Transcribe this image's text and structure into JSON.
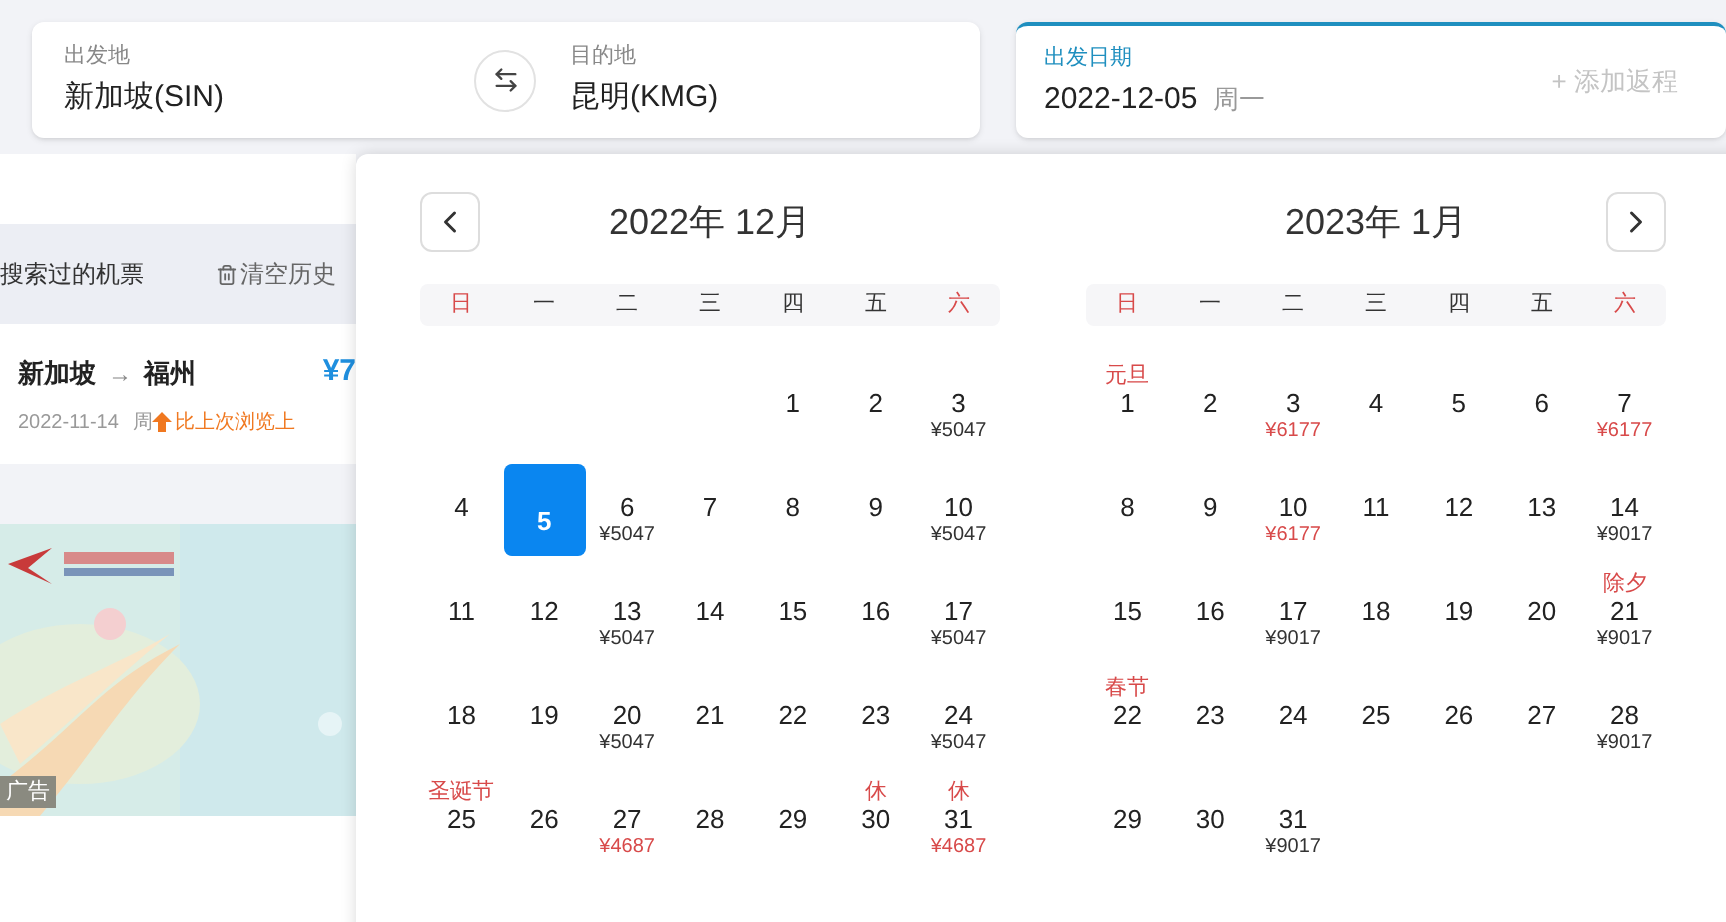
{
  "search": {
    "origin": {
      "label": "出发地",
      "value": "新加坡(SIN)"
    },
    "destination": {
      "label": "目的地",
      "value": "昆明(KMG)"
    },
    "date": {
      "label": "出发日期",
      "value": "2022-12-05",
      "weekday": "周一",
      "add_return": "+ 添加返程"
    }
  },
  "history": {
    "title": "搜索过的机票",
    "clear": "清空历史",
    "item": {
      "from": "新加坡",
      "arrow": "→",
      "to": "福州",
      "price": "¥7",
      "date": "2022-11-14",
      "weekday": "周",
      "trend": "比上次浏览上"
    }
  },
  "ad": {
    "kind": "picture",
    "tag": "广告"
  },
  "calendar": {
    "months": [
      {
        "title": "2022年 12月",
        "kind": "prev",
        "weekdays": [
          {
            "label": "日",
            "weekend": true
          },
          {
            "label": "一",
            "weekend": false
          },
          {
            "label": "二",
            "weekend": false
          },
          {
            "label": "三",
            "weekend": false
          },
          {
            "label": "四",
            "weekend": false
          },
          {
            "label": "五",
            "weekend": false
          },
          {
            "label": "六",
            "weekend": true
          }
        ],
        "days": [
          {
            "kind": "blank"
          },
          {
            "kind": "blank"
          },
          {
            "kind": "blank"
          },
          {
            "kind": "blank"
          },
          {
            "kind": "day",
            "day": "1",
            "selected": false
          },
          {
            "kind": "day",
            "day": "2",
            "selected": false
          },
          {
            "kind": "day",
            "day": "3",
            "selected": false,
            "price": "¥5047",
            "low": false
          },
          {
            "kind": "day",
            "day": "4",
            "selected": false
          },
          {
            "kind": "day",
            "day": "5",
            "selected": true
          },
          {
            "kind": "day",
            "day": "6",
            "selected": false,
            "price": "¥5047",
            "low": false
          },
          {
            "kind": "day",
            "day": "7",
            "selected": false
          },
          {
            "kind": "day",
            "day": "8",
            "selected": false
          },
          {
            "kind": "day",
            "day": "9",
            "selected": false
          },
          {
            "kind": "day",
            "day": "10",
            "selected": false,
            "price": "¥5047",
            "low": false
          },
          {
            "kind": "day",
            "day": "11",
            "selected": false
          },
          {
            "kind": "day",
            "day": "12",
            "selected": false
          },
          {
            "kind": "day",
            "day": "13",
            "selected": false,
            "price": "¥5047",
            "low": false
          },
          {
            "kind": "day",
            "day": "14",
            "selected": false
          },
          {
            "kind": "day",
            "day": "15",
            "selected": false
          },
          {
            "kind": "day",
            "day": "16",
            "selected": false
          },
          {
            "kind": "day",
            "day": "17",
            "selected": false,
            "price": "¥5047",
            "low": false
          },
          {
            "kind": "day",
            "day": "18",
            "selected": false
          },
          {
            "kind": "day",
            "day": "19",
            "selected": false
          },
          {
            "kind": "day",
            "day": "20",
            "selected": false,
            "price": "¥5047",
            "low": false
          },
          {
            "kind": "day",
            "day": "21",
            "selected": false
          },
          {
            "kind": "day",
            "day": "22",
            "selected": false
          },
          {
            "kind": "day",
            "day": "23",
            "selected": false
          },
          {
            "kind": "day",
            "day": "24",
            "selected": false,
            "price": "¥5047",
            "low": false
          },
          {
            "kind": "day",
            "day": "25",
            "selected": false,
            "holiday": "圣诞节"
          },
          {
            "kind": "day",
            "day": "26",
            "selected": false
          },
          {
            "kind": "day",
            "day": "27",
            "selected": false,
            "price": "¥4687",
            "low": true
          },
          {
            "kind": "day",
            "day": "28",
            "selected": false
          },
          {
            "kind": "day",
            "day": "29",
            "selected": false
          },
          {
            "kind": "day",
            "day": "30",
            "selected": false,
            "holiday": "休"
          },
          {
            "kind": "day",
            "day": "31",
            "selected": false,
            "holiday": "休",
            "price": "¥4687",
            "low": true
          }
        ]
      },
      {
        "title": "2023年 1月",
        "kind": "next",
        "weekdays": [
          {
            "label": "日",
            "weekend": true
          },
          {
            "label": "一",
            "weekend": false
          },
          {
            "label": "二",
            "weekend": false
          },
          {
            "label": "三",
            "weekend": false
          },
          {
            "label": "四",
            "weekend": false
          },
          {
            "label": "五",
            "weekend": false
          },
          {
            "label": "六",
            "weekend": true
          }
        ],
        "days": [
          {
            "kind": "day",
            "day": "1",
            "selected": false,
            "holiday": "元旦"
          },
          {
            "kind": "day",
            "day": "2",
            "selected": false
          },
          {
            "kind": "day",
            "day": "3",
            "selected": false,
            "price": "¥6177",
            "low": true
          },
          {
            "kind": "day",
            "day": "4",
            "selected": false
          },
          {
            "kind": "day",
            "day": "5",
            "selected": false
          },
          {
            "kind": "day",
            "day": "6",
            "selected": false
          },
          {
            "kind": "day",
            "day": "7",
            "selected": false,
            "price": "¥6177",
            "low": true
          },
          {
            "kind": "day",
            "day": "8",
            "selected": false
          },
          {
            "kind": "day",
            "day": "9",
            "selected": false
          },
          {
            "kind": "day",
            "day": "10",
            "selected": false,
            "price": "¥6177",
            "low": true
          },
          {
            "kind": "day",
            "day": "11",
            "selected": false
          },
          {
            "kind": "day",
            "day": "12",
            "selected": false
          },
          {
            "kind": "day",
            "day": "13",
            "selected": false
          },
          {
            "kind": "day",
            "day": "14",
            "selected": false,
            "price": "¥9017",
            "low": false
          },
          {
            "kind": "day",
            "day": "15",
            "selected": false
          },
          {
            "kind": "day",
            "day": "16",
            "selected": false
          },
          {
            "kind": "day",
            "day": "17",
            "selected": false,
            "price": "¥9017",
            "low": false
          },
          {
            "kind": "day",
            "day": "18",
            "selected": false
          },
          {
            "kind": "day",
            "day": "19",
            "selected": false
          },
          {
            "kind": "day",
            "day": "20",
            "selected": false
          },
          {
            "kind": "day",
            "day": "21",
            "selected": false,
            "holiday": "除夕",
            "price": "¥9017",
            "low": false
          },
          {
            "kind": "day",
            "day": "22",
            "selected": false,
            "holiday": "春节"
          },
          {
            "kind": "day",
            "day": "23",
            "selected": false
          },
          {
            "kind": "day",
            "day": "24",
            "selected": false
          },
          {
            "kind": "day",
            "day": "25",
            "selected": false
          },
          {
            "kind": "day",
            "day": "26",
            "selected": false
          },
          {
            "kind": "day",
            "day": "27",
            "selected": false
          },
          {
            "kind": "day",
            "day": "28",
            "selected": false,
            "price": "¥9017",
            "low": false
          },
          {
            "kind": "day",
            "day": "29",
            "selected": false
          },
          {
            "kind": "day",
            "day": "30",
            "selected": false
          },
          {
            "kind": "day",
            "day": "31",
            "selected": false,
            "price": "¥9017",
            "low": false
          }
        ]
      }
    ]
  }
}
